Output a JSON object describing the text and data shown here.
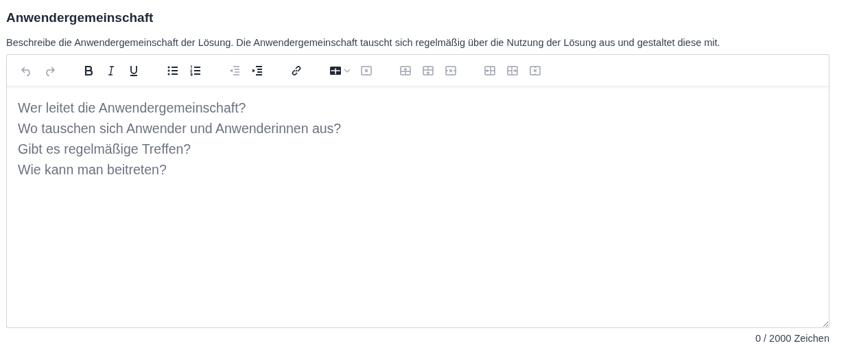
{
  "section": {
    "title": "Anwendergemeinschaft",
    "description": "Beschreibe die Anwendergemeinschaft der Lösung. Die Anwendergemeinschaft tauscht sich regelmäßig über die Nutzung der Lösung aus und gestaltet diese mit."
  },
  "toolbar": [
    [
      {
        "kind": "undo",
        "disabled": true
      },
      {
        "kind": "redo",
        "disabled": true
      }
    ],
    [
      {
        "kind": "bold",
        "disabled": false
      },
      {
        "kind": "italic",
        "disabled": false
      },
      {
        "kind": "underline",
        "disabled": false
      }
    ],
    [
      {
        "kind": "bullets",
        "disabled": false
      },
      {
        "kind": "numbers",
        "disabled": false
      }
    ],
    [
      {
        "kind": "outdent",
        "disabled": true
      },
      {
        "kind": "indent",
        "disabled": false
      }
    ],
    [
      {
        "kind": "link",
        "disabled": false
      }
    ],
    [
      {
        "kind": "table",
        "disabled": false
      },
      {
        "kind": "delete-table",
        "disabled": true
      }
    ],
    [
      {
        "kind": "row-above",
        "disabled": true
      },
      {
        "kind": "row-below",
        "disabled": true
      },
      {
        "kind": "delete-row",
        "disabled": true
      }
    ],
    [
      {
        "kind": "col-left",
        "disabled": true
      },
      {
        "kind": "col-right",
        "disabled": true
      },
      {
        "kind": "delete-col",
        "disabled": true
      }
    ]
  ],
  "editor": {
    "placeholder": "Wer leitet die Anwendergemeinschaft?\nWo tauschen sich Anwender und Anwenderinnen aus?\nGibt es regelmäßige Treffen?\nWie kann man beitreten?"
  },
  "counter": "0 / 2000 Zeichen"
}
